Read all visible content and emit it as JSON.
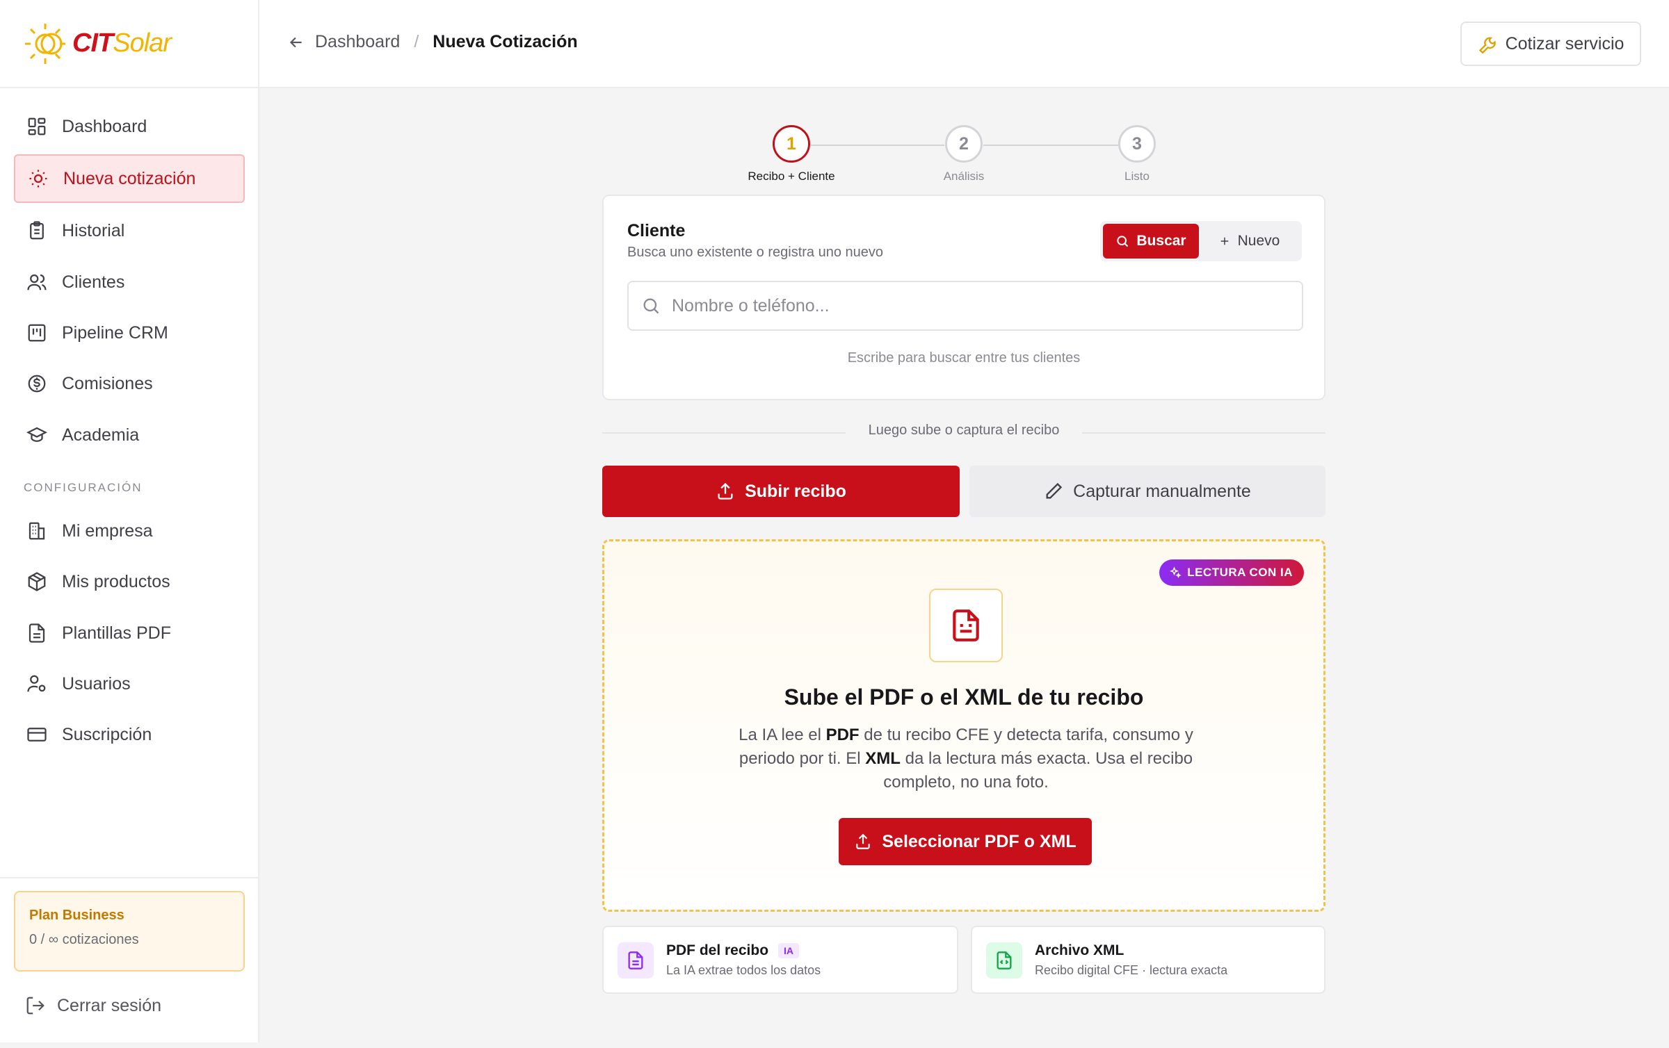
{
  "brand": {
    "part1": "CIT",
    "part2": "Solar"
  },
  "sidebar": {
    "items": [
      {
        "label": "Dashboard",
        "icon": "dashboard-grid-icon"
      },
      {
        "label": "Nueva cotización",
        "icon": "sun-icon"
      },
      {
        "label": "Historial",
        "icon": "clipboard-icon"
      },
      {
        "label": "Clientes",
        "icon": "users-icon"
      },
      {
        "label": "Pipeline CRM",
        "icon": "kanban-icon"
      },
      {
        "label": "Comisiones",
        "icon": "dollar-circle-icon"
      },
      {
        "label": "Academia",
        "icon": "graduation-cap-icon"
      }
    ],
    "section_label": "CONFIGURACIÓN",
    "config_items": [
      {
        "label": "Mi empresa",
        "icon": "building-icon"
      },
      {
        "label": "Mis productos",
        "icon": "package-icon"
      },
      {
        "label": "Plantillas PDF",
        "icon": "file-text-icon"
      },
      {
        "label": "Usuarios",
        "icon": "user-cog-icon"
      },
      {
        "label": "Suscripción",
        "icon": "credit-card-icon"
      }
    ],
    "plan": {
      "title": "Plan Business",
      "usage": "0 / ∞ cotizaciones"
    },
    "logout": "Cerrar sesión"
  },
  "header": {
    "breadcrumb_parent": "Dashboard",
    "breadcrumb_sep": "/",
    "breadcrumb_current": "Nueva Cotización",
    "cta": "Cotizar servicio"
  },
  "stepper": [
    {
      "num": "1",
      "label": "Recibo + Cliente",
      "state": "active"
    },
    {
      "num": "2",
      "label": "Análisis",
      "state": "pending"
    },
    {
      "num": "3",
      "label": "Listo",
      "state": "pending"
    }
  ],
  "client": {
    "title": "Cliente",
    "subtitle": "Busca uno existente o registra uno nuevo",
    "search_btn": "Buscar",
    "new_btn": "Nuevo",
    "search_placeholder": "Nombre o teléfono...",
    "hint": "Escribe para buscar entre tus clientes"
  },
  "separator_text": "Luego sube o captura el recibo",
  "tabs": {
    "upload": "Subir recibo",
    "manual": "Capturar manualmente"
  },
  "dropzone": {
    "badge": "LECTURA CON IA",
    "title": "Sube el PDF o el XML de tu recibo",
    "desc_1": "La IA lee el ",
    "desc_pdf": "PDF",
    "desc_2": " de tu recibo CFE y detecta tarifa, consumo y periodo por ti. El ",
    "desc_xml": "XML",
    "desc_3": " da la lectura más exacta. Usa el recibo completo, no una foto.",
    "button": "Seleccionar PDF o XML"
  },
  "info_cards": [
    {
      "title": "PDF del recibo",
      "tag": "IA",
      "subtitle": "La IA extrae todos los datos"
    },
    {
      "title": "Archivo XML",
      "subtitle": "Recibo digital CFE · lectura exacta"
    }
  ],
  "colors": {
    "primary": "#c8101a",
    "accent": "#f3b400",
    "ia_purple": "#8b2cf5",
    "xml_green": "#16a34a"
  }
}
